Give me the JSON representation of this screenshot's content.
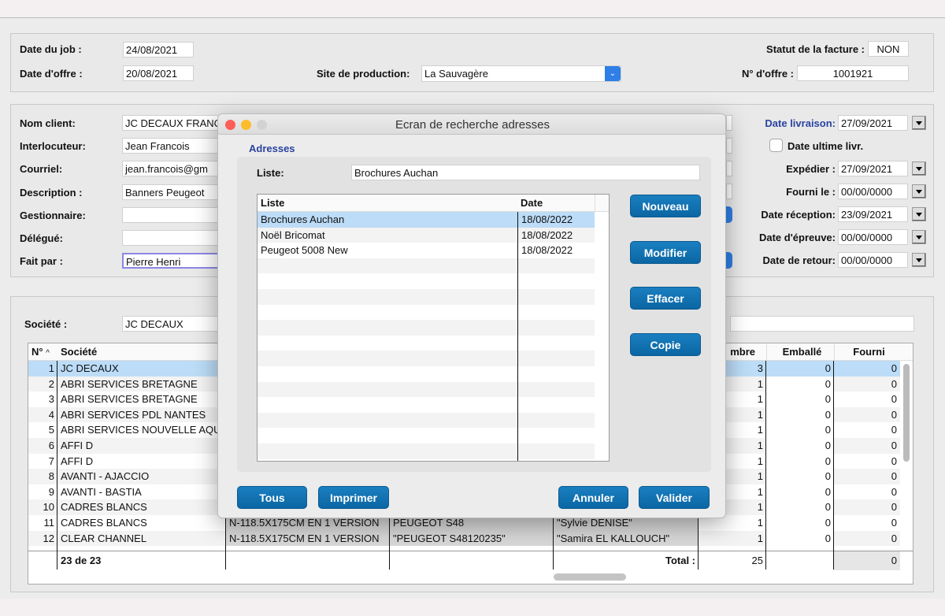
{
  "header": {
    "job_date_label": "Date du job :",
    "job_date": "24/08/2021",
    "offer_date_label": "Date d'offre :",
    "offer_date": "20/08/2021",
    "site_label": "Site de production:",
    "site_value": "La Sauvagère",
    "invoice_status_label": "Statut de la facture :",
    "invoice_status": "NON",
    "offer_no_label": "N° d'offre :",
    "offer_no": "1001921"
  },
  "client": {
    "fields": [
      {
        "label": "Nom client:",
        "value": "JC DECAUX FRANC"
      },
      {
        "label": "Interlocuteur:",
        "value": "Jean Francois"
      },
      {
        "label": "Courriel:",
        "value": "jean.francois@gm"
      },
      {
        "label": "Description :",
        "value": "Banners Peugeot"
      },
      {
        "label": "Gestionnaire:",
        "value": ""
      },
      {
        "label": "Délégué:",
        "value": ""
      },
      {
        "label": "Fait par :",
        "value": "Pierre Henri"
      }
    ],
    "dates": [
      {
        "label": "Date livraison:",
        "value": "27/09/2021"
      },
      {
        "label": "Expédier :",
        "value": "27/09/2021"
      },
      {
        "label": "Fourni le :",
        "value": "00/00/0000"
      },
      {
        "label": "Date réception:",
        "value": "23/09/2021"
      },
      {
        "label": "Date d'épreuve:",
        "value": "00/00/0000"
      },
      {
        "label": "Date de retour:",
        "value": "00/00/0000"
      }
    ],
    "ultimate_label": "Date ultime livr.",
    "ultimate_checked": false
  },
  "societe": {
    "label": "Société :",
    "value": "JC DECAUX"
  },
  "table": {
    "headers": [
      "N°",
      "Société",
      "mbre",
      "Emballé",
      "Fourni"
    ],
    "rows": [
      [
        "1",
        "JC DECAUX",
        "",
        "",
        "",
        "3",
        "0",
        "0"
      ],
      [
        "2",
        "ABRI SERVICES BRETAGNE",
        "",
        "",
        "",
        "1",
        "0",
        "0"
      ],
      [
        "3",
        "ABRI SERVICES BRETAGNE",
        "",
        "",
        "",
        "1",
        "0",
        "0"
      ],
      [
        "4",
        "ABRI SERVICES PDL NANTES",
        "",
        "",
        "",
        "1",
        "0",
        "0"
      ],
      [
        "5",
        "ABRI SERVICES NOUVELLE AQU",
        "",
        "",
        "",
        "1",
        "0",
        "0"
      ],
      [
        "6",
        "AFFI D",
        "",
        "",
        "",
        "1",
        "0",
        "0"
      ],
      [
        "7",
        "AFFI D",
        "",
        "",
        "",
        "1",
        "0",
        "0"
      ],
      [
        "8",
        "AVANTI - AJACCIO",
        "",
        "",
        "",
        "1",
        "0",
        "0"
      ],
      [
        "9",
        "AVANTI - BASTIA",
        "",
        "",
        "",
        "1",
        "0",
        "0"
      ],
      [
        "10",
        "CADRES BLANCS",
        "",
        "",
        "",
        "1",
        "0",
        "0"
      ],
      [
        "11",
        "CADRES BLANCS",
        "N-118.5X175CM EN 1 VERSION",
        "PEUGEOT S48",
        "\"Sylvie DENISE\"",
        "1",
        "0",
        "0"
      ],
      [
        "12",
        "CLEAR CHANNEL",
        "N-118.5X175CM EN 1 VERSION",
        "\"PEUGEOT S48120235\"",
        "\"Samira EL KALLOUCH\"",
        "1",
        "0",
        "0"
      ]
    ],
    "footer_count": "23 de 23",
    "total_label": "Total :",
    "total_nombre": "25",
    "total_fourni": "0"
  },
  "dialog": {
    "title": "Ecran de recherche adresses",
    "section": "Adresses",
    "list_label": "Liste:",
    "list_value": "Brochures Auchan",
    "columns": [
      "Liste",
      "Date"
    ],
    "rows": [
      [
        "Brochures Auchan",
        "18/08/2022"
      ],
      [
        "Noël Bricomat",
        "18/08/2022"
      ],
      [
        "Peugeot 5008 New",
        "18/08/2022"
      ]
    ],
    "buttons": {
      "new": "Nouveau",
      "edit": "Modifier",
      "delete": "Effacer",
      "copy": "Copie",
      "all": "Tous",
      "print": "Imprimer",
      "cancel": "Annuler",
      "ok": "Valider"
    }
  },
  "colors": {
    "accent": "#0b6fae",
    "selection": "#bcdcf7",
    "link_label": "#2a43a0"
  }
}
